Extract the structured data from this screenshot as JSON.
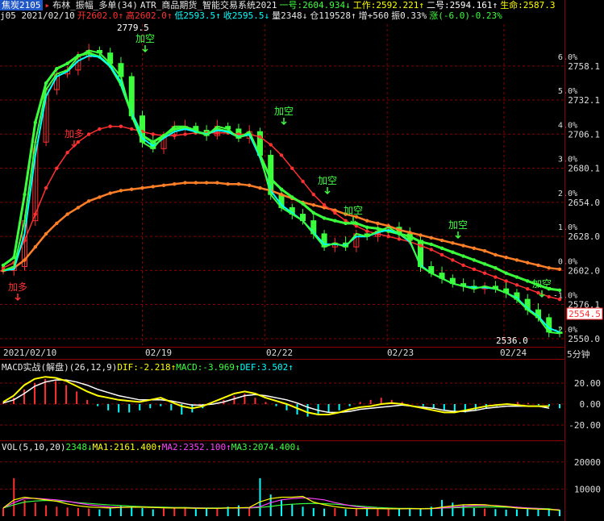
{
  "header": {
    "row1": [
      {
        "text": "焦炭2105",
        "color": "#ffffff",
        "bg": "#1f56c8"
      },
      {
        "text": "▸",
        "color": "#ff3030"
      },
      {
        "text": "布林_振幅_多单(34)",
        "color": "#e8e8e8"
      },
      {
        "text": "ATR_商品期货_智能交易系统2021",
        "color": "#e8e8e8"
      },
      {
        "text": "一号:2604.934↓",
        "color": "#3cff3c"
      },
      {
        "text": "工作:2592.221↑",
        "color": "#ffff00"
      },
      {
        "text": "二号:2594.161↑",
        "color": "#ffffff"
      },
      {
        "text": "生命:2587.3",
        "color": "#ffff00"
      }
    ],
    "row2": [
      {
        "text": "j05 2021/02/10",
        "color": "#e8e8e8"
      },
      {
        "text": "开2602.0↑",
        "color": "#ff3030"
      },
      {
        "text": "高2602.0↑",
        "color": "#ff3030"
      },
      {
        "text": "低2593.5↑",
        "color": "#00ffff"
      },
      {
        "text": "收2595.5↓",
        "color": "#00ffff"
      },
      {
        "text": "量2348↓",
        "color": "#e8e8e8"
      },
      {
        "text": "仓119528↑",
        "color": "#e8e8e8"
      },
      {
        "text": "增+560",
        "color": "#e8e8e8"
      },
      {
        "text": "振0.33%",
        "color": "#e8e8e8"
      },
      {
        "text": "涨(-6.0)-0.23%",
        "color": "#3cff3c"
      }
    ]
  },
  "timeframe_label": "5分钟",
  "last_price_tag": "2554.5",
  "high_marker": "2779.5",
  "low_marker": "2536.0",
  "macd_header": [
    {
      "text": "MACD实战(解盘)(26,12,9)",
      "color": "#e8e8e8"
    },
    {
      "text": "DIF:-2.218↑",
      "color": "#ffff00"
    },
    {
      "text": "MACD:-3.969↑",
      "color": "#3cff3c"
    },
    {
      "text": "DEF:3.502↑",
      "color": "#00ffff"
    }
  ],
  "vol_header": [
    {
      "text": "VOL(5,10,20)",
      "color": "#e8e8e8"
    },
    {
      "text": "2348↓",
      "color": "#3cff3c"
    },
    {
      "text": "MA1:2161.400↑",
      "color": "#ffff00"
    },
    {
      "text": "MA2:2352.100↑",
      "color": "#ff40ff"
    },
    {
      "text": "MA3:2074.400↓",
      "color": "#3cff3c"
    }
  ],
  "annotations": [
    {
      "text": "加空",
      "color": "#3cff3c",
      "x": 75,
      "price": 2770
    },
    {
      "text": "加多",
      "color": "#ff3030",
      "x": 40,
      "price": 2706
    },
    {
      "text": "加空",
      "color": "#3cff3c",
      "x": 175,
      "price": 2714
    },
    {
      "text": "加空",
      "color": "#3cff3c",
      "x": 255,
      "price": 2661
    },
    {
      "text": "加空",
      "color": "#3cff3c",
      "x": 285,
      "price": 2647
    },
    {
      "text": "加空",
      "color": "#3cff3c",
      "x": 372,
      "price": 2627
    },
    {
      "text": "加空",
      "color": "#3cff3c",
      "x": 392,
      "price": 2576
    },
    {
      "text": "加多",
      "color": "#ff3030",
      "x": 5,
      "price": 2582
    }
  ],
  "colors": {
    "bg": "#000000",
    "grid": "#8b0000",
    "axis_text": "#dddddd",
    "up": "#ff3030",
    "down": "#3cff3c",
    "ma_fast": "#00ffff",
    "ma_mid": "#ff40ff",
    "boll_green": "#3cff3c",
    "boll_red": "#ff3030",
    "orange": "#ff7f27",
    "yellow": "#ffff00",
    "white": "#ffffff"
  },
  "chart_data": [
    {
      "type": "line",
      "title": "焦炭2105 5分钟",
      "xlabel": "",
      "ylabel": "",
      "ylim": [
        2545,
        2790
      ],
      "y_ticks": [
        2550.0,
        2576.1,
        2602.0,
        2628.0,
        2654.0,
        2680.1,
        2706.1,
        2732.1,
        2758.1
      ],
      "pct_ticks": [
        "6.0%",
        "5.0%",
        "4.0%",
        "3.0%",
        "2.0%",
        "1.0%",
        "0.0%",
        "-1.0%",
        "-2.0%"
      ],
      "x_labels": [
        "2021/02/10",
        "02/19",
        "02/22",
        "02/23",
        "02/24"
      ],
      "series": [
        {
          "name": "price",
          "color": "#3cff3c",
          "values": [
            2602,
            2605,
            2640,
            2700,
            2740,
            2752,
            2755,
            2765,
            2770,
            2768,
            2760,
            2750,
            2720,
            2700,
            2695,
            2705,
            2712,
            2712,
            2709,
            2705,
            2712,
            2710,
            2703,
            2708,
            2690,
            2660,
            2650,
            2645,
            2640,
            2630,
            2620,
            2623,
            2620,
            2630,
            2628,
            2632,
            2635,
            2630,
            2625,
            2605,
            2600,
            2596,
            2592,
            2590,
            2588,
            2590,
            2588,
            2585,
            2580,
            2572,
            2566,
            2555,
            2554
          ]
        },
        {
          "name": "ma_fast",
          "color": "#00ffff",
          "values": [
            2602,
            2603,
            2630,
            2690,
            2735,
            2750,
            2754,
            2762,
            2766,
            2765,
            2758,
            2746,
            2722,
            2703,
            2697,
            2703,
            2708,
            2710,
            2708,
            2706,
            2709,
            2708,
            2704,
            2706,
            2688,
            2663,
            2652,
            2646,
            2640,
            2631,
            2622,
            2622,
            2621,
            2628,
            2628,
            2631,
            2633,
            2630,
            2624,
            2606,
            2600,
            2596,
            2592,
            2590,
            2589,
            2589,
            2588,
            2585,
            2581,
            2573,
            2567,
            2558,
            2555
          ]
        },
        {
          "name": "boll_green",
          "color": "#3cff3c",
          "values": [
            2606,
            2612,
            2660,
            2715,
            2745,
            2756,
            2760,
            2766,
            2768,
            2765,
            2758,
            2744,
            2722,
            2705,
            2700,
            2705,
            2710,
            2711,
            2708,
            2706,
            2710,
            2708,
            2704,
            2706,
            2690,
            2672,
            2664,
            2658,
            2653,
            2646,
            2642,
            2640,
            2638,
            2638,
            2635,
            2634,
            2632,
            2630,
            2628,
            2624,
            2622,
            2619,
            2616,
            2613,
            2610,
            2607,
            2604,
            2600,
            2597,
            2594,
            2591,
            2588,
            2587
          ]
        },
        {
          "name": "boll_red",
          "color": "#ff3030",
          "values": [
            2604,
            2608,
            2625,
            2645,
            2665,
            2680,
            2692,
            2700,
            2706,
            2710,
            2712,
            2712,
            2710,
            2708,
            2706,
            2705,
            2705,
            2706,
            2707,
            2707,
            2707,
            2707,
            2706,
            2706,
            2704,
            2698,
            2690,
            2680,
            2670,
            2660,
            2652,
            2646,
            2640,
            2636,
            2632,
            2630,
            2628,
            2626,
            2624,
            2621,
            2618,
            2614,
            2610,
            2606,
            2603,
            2600,
            2597,
            2594,
            2591,
            2588,
            2585,
            2582,
            2580
          ]
        },
        {
          "name": "orange",
          "color": "#ff7f27",
          "values": [
            2602,
            2604,
            2610,
            2620,
            2630,
            2638,
            2645,
            2650,
            2655,
            2658,
            2661,
            2663,
            2664,
            2665,
            2666,
            2667,
            2668,
            2669,
            2669,
            2669,
            2669,
            2668,
            2668,
            2667,
            2665,
            2663,
            2660,
            2657,
            2654,
            2652,
            2650,
            2648,
            2645,
            2643,
            2640,
            2638,
            2636,
            2633,
            2631,
            2629,
            2627,
            2625,
            2623,
            2621,
            2619,
            2617,
            2614,
            2612,
            2610,
            2608,
            2606,
            2604,
            2603
          ]
        }
      ]
    },
    {
      "type": "bar",
      "title": "MACD",
      "ylim": [
        -30,
        30
      ],
      "y_ticks": [
        20.0,
        0.0,
        -20.0
      ],
      "values": [
        2,
        6,
        14,
        20,
        24,
        22,
        18,
        12,
        4,
        -2,
        -6,
        -8,
        -8,
        -6,
        -4,
        -2,
        -6,
        -10,
        -8,
        -4,
        0,
        4,
        8,
        10,
        6,
        2,
        -2,
        -6,
        -10,
        -12,
        -10,
        -8,
        -6,
        -2,
        2,
        4,
        6,
        4,
        2,
        0,
        -2,
        -4,
        -6,
        -8,
        -8,
        -6,
        -4,
        -2,
        0,
        2,
        1,
        -1,
        -2,
        -4
      ],
      "dif": [
        2,
        8,
        18,
        24,
        26,
        25,
        22,
        17,
        12,
        8,
        6,
        4,
        3,
        2,
        4,
        6,
        2,
        -2,
        -4,
        -2,
        2,
        6,
        10,
        12,
        10,
        6,
        3,
        0,
        -4,
        -8,
        -10,
        -10,
        -8,
        -5,
        -3,
        -2,
        0,
        1,
        0,
        -2,
        -4,
        -6,
        -8,
        -8,
        -6,
        -4,
        -2,
        -1,
        0,
        -1,
        -2,
        -2,
        -2
      ],
      "dea": [
        1,
        4,
        10,
        17,
        21,
        23,
        23,
        21,
        18,
        14,
        11,
        8,
        6,
        4,
        4,
        4,
        3,
        1,
        -1,
        -1,
        0,
        2,
        5,
        8,
        9,
        8,
        6,
        4,
        1,
        -3,
        -6,
        -8,
        -8,
        -7,
        -5,
        -4,
        -3,
        -2,
        -1,
        -2,
        -3,
        -4,
        -6,
        -7,
        -7,
        -6,
        -4,
        -3,
        -2,
        -2,
        -2,
        -2,
        -4
      ]
    },
    {
      "type": "bar",
      "title": "VOL",
      "ylim": [
        0,
        25000
      ],
      "y_ticks": [
        20000,
        10000
      ],
      "values": [
        3000,
        14000,
        6000,
        5000,
        4000,
        3500,
        3200,
        3000,
        2800,
        2500,
        3000,
        4000,
        3500,
        3000,
        2500,
        2800,
        3200,
        3000,
        2600,
        2800,
        3000,
        3500,
        4000,
        3000,
        14000,
        8000,
        6000,
        4500,
        3500,
        3000,
        2800,
        3000,
        2600,
        2800,
        3000,
        2700,
        2500,
        2800,
        3000,
        2600,
        3500,
        6000,
        5000,
        4000,
        3000,
        2800,
        2600,
        2400,
        2500,
        2600,
        2400,
        2500,
        2348
      ],
      "ma1": [
        3000,
        6000,
        7000,
        6500,
        6000,
        5500,
        4500,
        3800,
        3400,
        3200,
        3000,
        3200,
        3300,
        3300,
        3200,
        3100,
        3000,
        3000,
        2900,
        2900,
        2900,
        3000,
        3100,
        3200,
        5300,
        6500,
        7000,
        7000,
        7300,
        5200,
        4200,
        3500,
        3000,
        2800,
        2800,
        2800,
        2700,
        2700,
        2800,
        2700,
        2800,
        3300,
        3800,
        4200,
        4300,
        4200,
        3800,
        3500,
        3000,
        2800,
        2600,
        2500,
        2161
      ],
      "ma2": [
        3000,
        5000,
        6500,
        6600,
        6300,
        6000,
        5500,
        4800,
        4200,
        3800,
        3400,
        3300,
        3300,
        3300,
        3200,
        3100,
        3100,
        3000,
        3000,
        2900,
        2900,
        3000,
        3000,
        3100,
        3500,
        5000,
        6000,
        6500,
        6800,
        6500,
        6000,
        5000,
        4200,
        3500,
        3100,
        2900,
        2800,
        2700,
        2800,
        2700,
        2800,
        3000,
        3300,
        3600,
        3900,
        4000,
        3900,
        3600,
        3300,
        3000,
        2800,
        2500,
        2352
      ],
      "ma3": [
        3000,
        4200,
        5200,
        5600,
        5800,
        5600,
        5400,
        5000,
        4700,
        4400,
        4100,
        3900,
        3700,
        3500,
        3400,
        3300,
        3200,
        3200,
        3100,
        3000,
        3000,
        3000,
        3000,
        3000,
        3200,
        3600,
        4100,
        4400,
        4600,
        4700,
        4600,
        4400,
        4100,
        3800,
        3500,
        3200,
        3000,
        2900,
        2900,
        2800,
        2900,
        3000,
        3100,
        3200,
        3300,
        3400,
        3400,
        3300,
        3200,
        3000,
        2900,
        2700,
        2074
      ]
    }
  ]
}
